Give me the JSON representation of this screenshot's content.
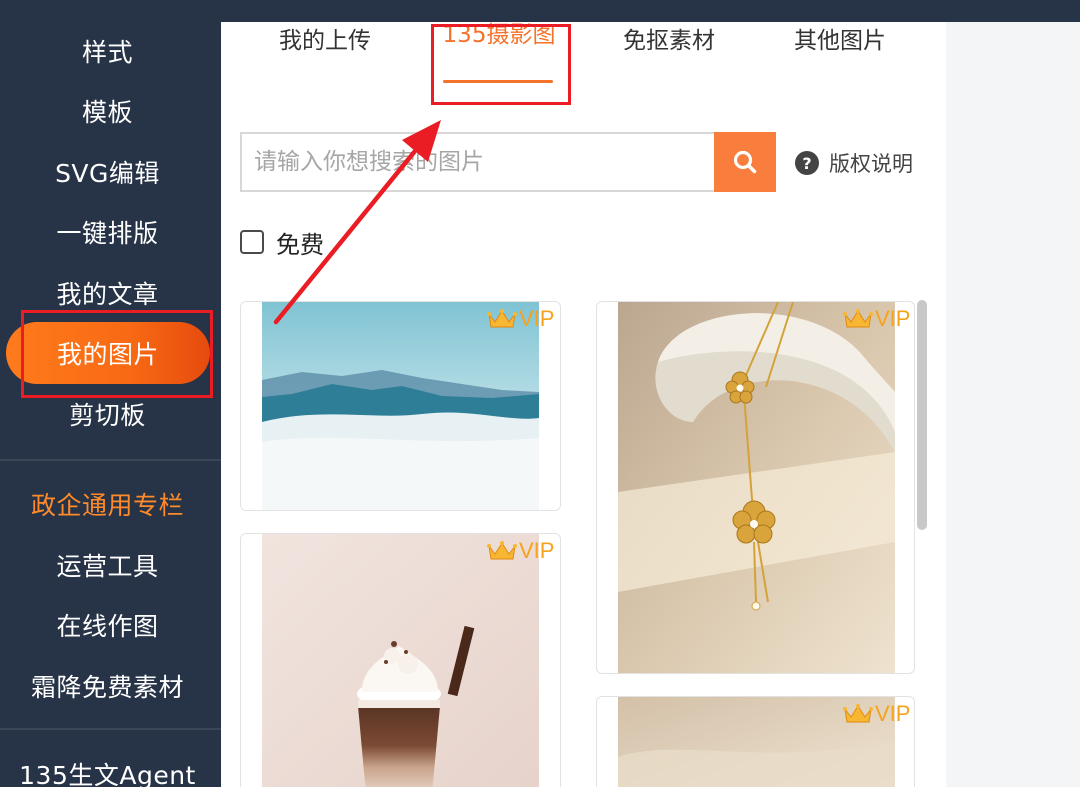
{
  "sidebar": {
    "items": [
      {
        "label": "样式"
      },
      {
        "label": "模板"
      },
      {
        "label": "SVG编辑"
      },
      {
        "label": "一键排版"
      },
      {
        "label": "我的文章"
      },
      {
        "label": "我的图片",
        "active": true
      },
      {
        "label": "剪切板"
      },
      {
        "label": "政企通用专栏",
        "highlight": true
      },
      {
        "label": "运营工具"
      },
      {
        "label": "在线作图"
      },
      {
        "label": "霜降免费素材"
      },
      {
        "label": "135生文Agent"
      }
    ]
  },
  "tabs": [
    {
      "label": "我的上传"
    },
    {
      "label": "135摄影图",
      "active": true
    },
    {
      "label": "免抠素材"
    },
    {
      "label": "其他图片"
    }
  ],
  "search": {
    "placeholder": "请输入你想搜索的图片",
    "value": ""
  },
  "copyright": {
    "label": "版权说明"
  },
  "filter": {
    "free_label": "免费",
    "checked": false
  },
  "cards": [
    {
      "badge": "VIP",
      "subject": "misty mountains"
    },
    {
      "badge": "VIP",
      "subject": "iced mocha drink"
    },
    {
      "badge": "VIP",
      "subject": "gold flower necklace"
    },
    {
      "badge": "VIP",
      "subject": "fur texture"
    }
  ],
  "colors": {
    "sidebar_bg": "#273347",
    "accent": "#f5722a",
    "vip": "#f7a21b",
    "annotation": "#ea1c24"
  }
}
